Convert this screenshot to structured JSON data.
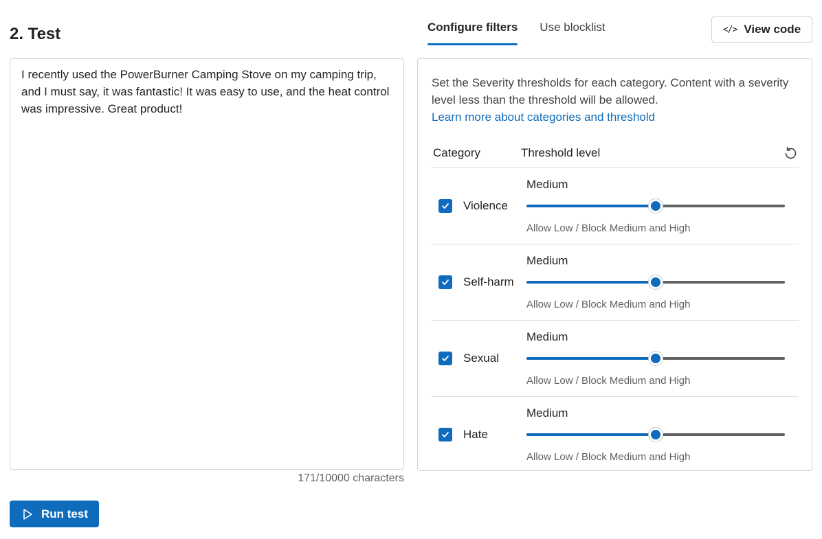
{
  "page": {
    "title": "2. Test"
  },
  "input": {
    "text": "I recently used the PowerBurner Camping Stove on my camping trip, and I must say, it was fantastic! It was easy to use, and the heat control was impressive. Great product!",
    "char_count": "171/10000 characters"
  },
  "actions": {
    "run_test": "Run test",
    "view_code": "View code"
  },
  "tabs": [
    {
      "label": "Configure filters",
      "active": true
    },
    {
      "label": "Use blocklist",
      "active": false
    }
  ],
  "panel": {
    "description": "Set the Severity thresholds for each category. Content with a severity level less than the threshold will be allowed.",
    "learn_more": "Learn more about categories and threshold",
    "col_category": "Category",
    "col_threshold": "Threshold level"
  },
  "categories": [
    {
      "name": "Violence",
      "checked": true,
      "level": "Medium",
      "level_fraction": 0.5,
      "hint": "Allow Low / Block Medium and High"
    },
    {
      "name": "Self-harm",
      "checked": true,
      "level": "Medium",
      "level_fraction": 0.5,
      "hint": "Allow Low / Block Medium and High"
    },
    {
      "name": "Sexual",
      "checked": true,
      "level": "Medium",
      "level_fraction": 0.5,
      "hint": "Allow Low / Block Medium and High"
    },
    {
      "name": "Hate",
      "checked": true,
      "level": "Medium",
      "level_fraction": 0.5,
      "hint": "Allow Low / Block Medium and High"
    }
  ],
  "colors": {
    "accent": "#0f6cbd",
    "track": "#616161",
    "border": "#d1d1d1"
  },
  "icons": {
    "run": "play-icon",
    "view_code": "code-icon",
    "reset": "reset-icon",
    "checkbox": "checkmark-icon"
  }
}
